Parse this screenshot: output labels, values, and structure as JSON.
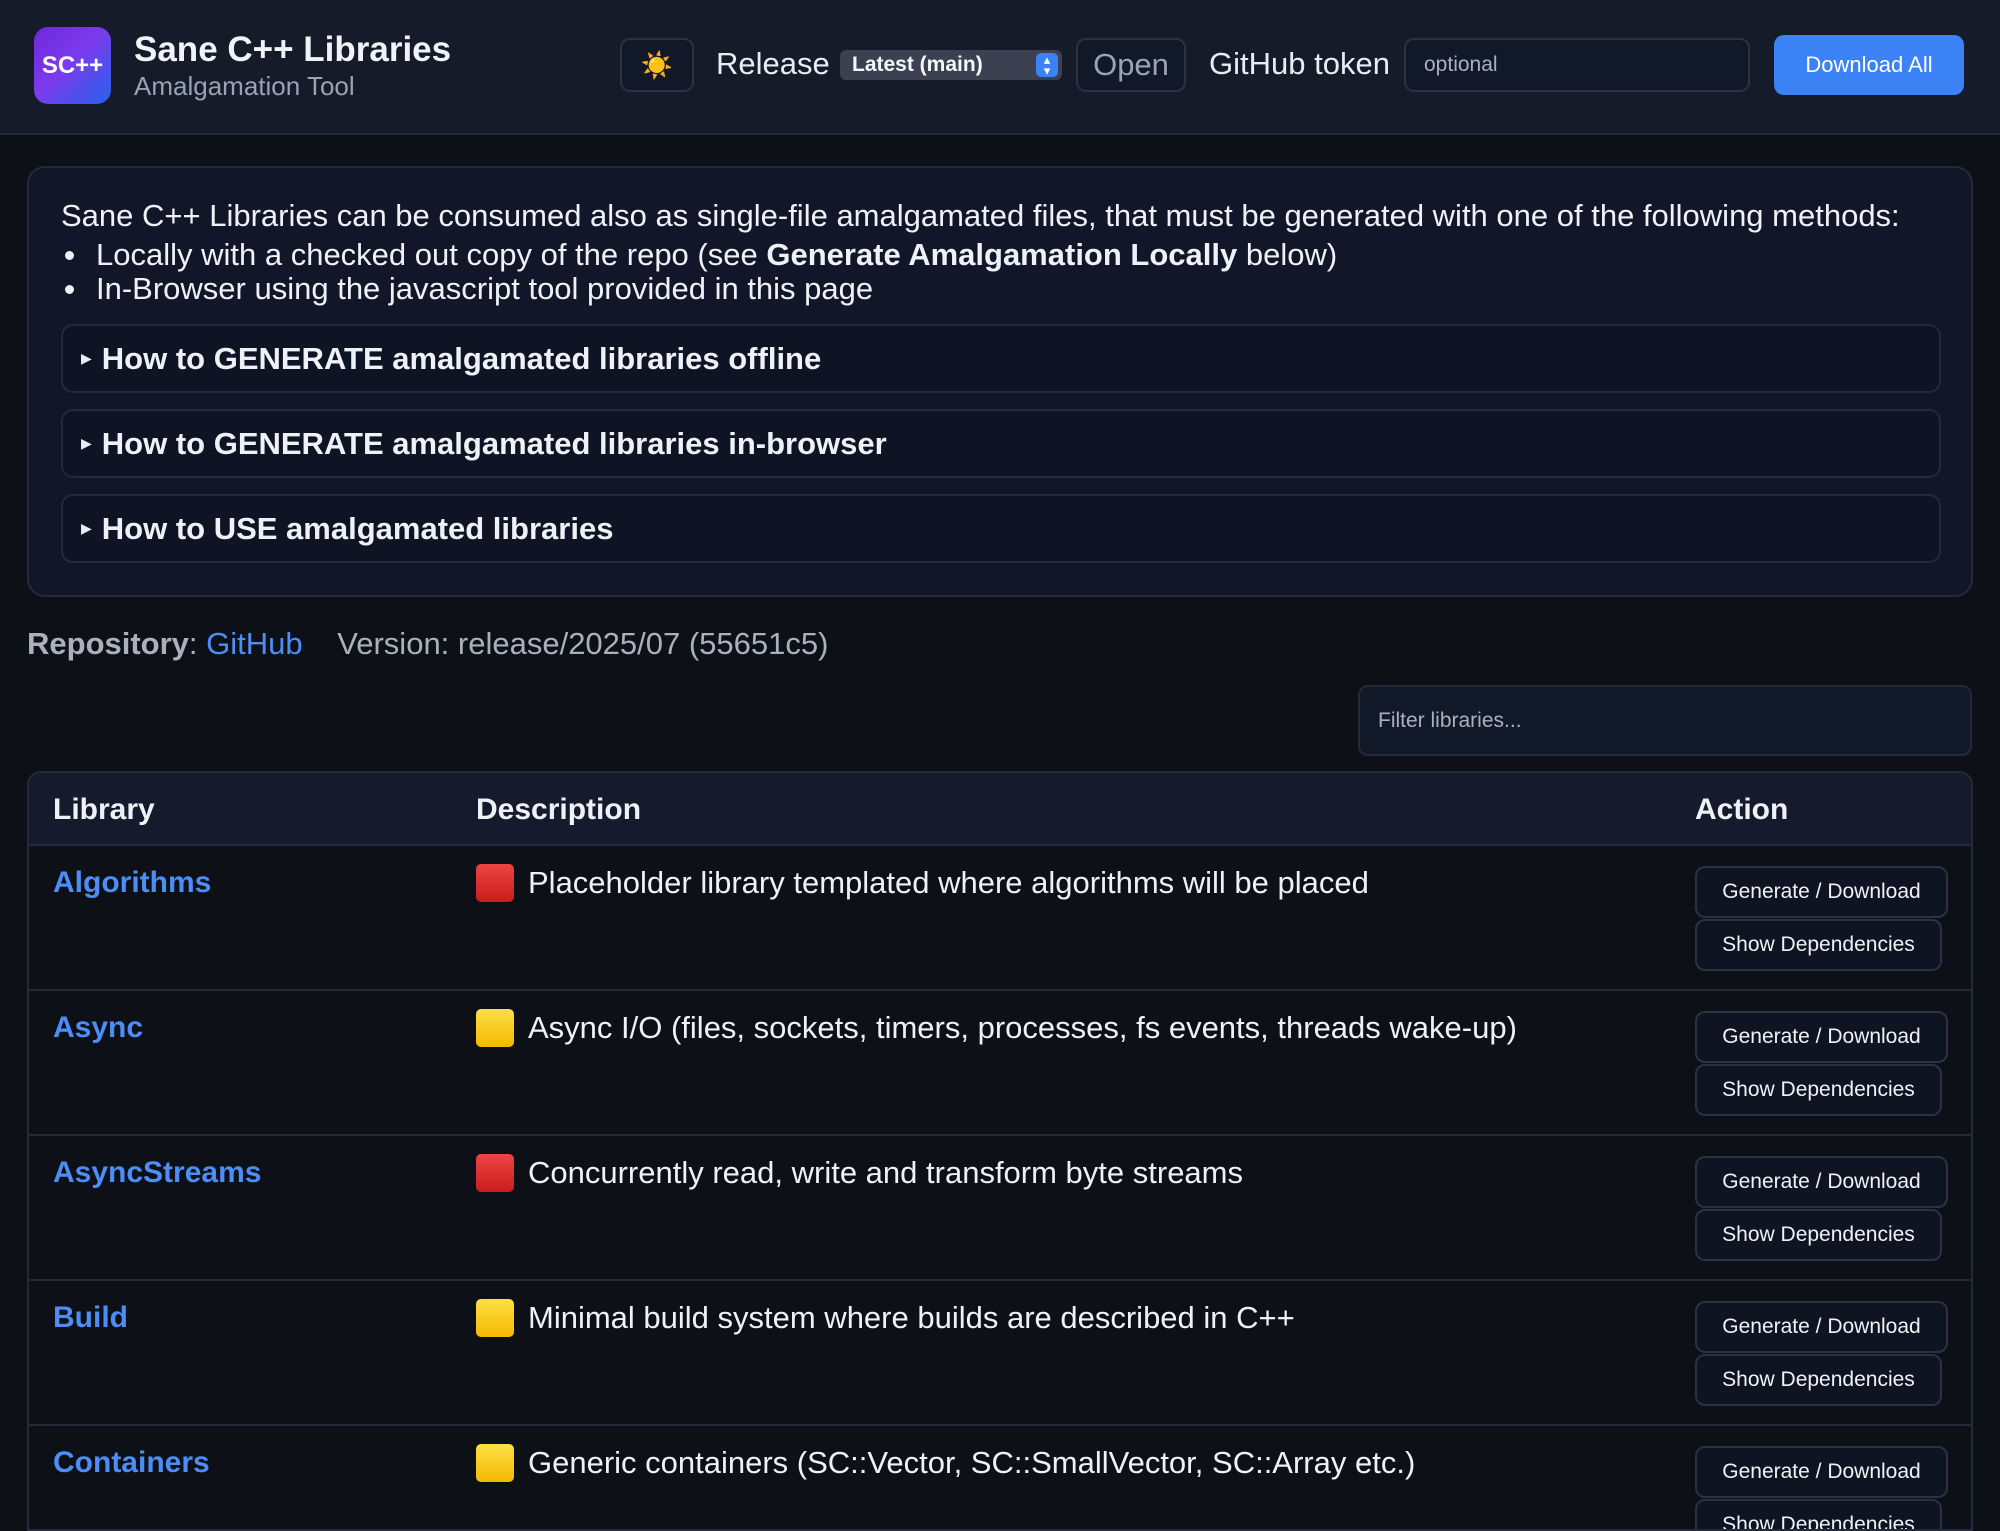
{
  "header": {
    "logo_text": "SC++",
    "title": "Sane C++ Libraries",
    "subtitle": "Amalgamation Tool",
    "theme_icon": "sun-icon",
    "theme_glyph": "☀️",
    "release_label": "Release",
    "release_selected": "Latest (main)",
    "open_label": "Open",
    "token_label": "GitHub token",
    "token_placeholder": "optional",
    "download_all_label": "Download All",
    "accent_color": "#3b82f6"
  },
  "info": {
    "intro": "Sane C++ Libraries can be consumed also as single-file amalgamated files, that must be generated with one of the following methods:",
    "bullet1_pre": "Locally with a checked out copy of the repo (see ",
    "bullet1_bold": "Generate Amalgamation Locally",
    "bullet1_post": " below)",
    "bullet2": "In-Browser using the javascript tool provided in this page",
    "sections": [
      "How to GENERATE amalgamated libraries offline",
      "How to GENERATE amalgamated libraries in-browser",
      "How to USE amalgamated libraries"
    ]
  },
  "repo": {
    "label": "Repository",
    "separator": ":",
    "link_text": "GitHub",
    "version": "Version: release/2025/07 (55651c5)"
  },
  "filter_placeholder": "Filter libraries...",
  "table": {
    "headers": [
      "Library",
      "Description",
      "Action"
    ],
    "generate_label": "Generate / Download",
    "deps_label": "Show Dependencies",
    "rows": [
      {
        "name": "Algorithms",
        "status": "red",
        "description": "Placeholder library templated where algorithms will be placed"
      },
      {
        "name": "Async",
        "status": "yellow",
        "description": "Async I/O (files, sockets, timers, processes, fs events, threads wake-up)"
      },
      {
        "name": "AsyncStreams",
        "status": "red",
        "description": "Concurrently read, write and transform byte streams"
      },
      {
        "name": "Build",
        "status": "yellow",
        "description": "Minimal build system where builds are described in C++"
      },
      {
        "name": "Containers",
        "status": "yellow",
        "description": "Generic containers (SC::Vector, SC::SmallVector, SC::Array etc.)"
      }
    ]
  }
}
